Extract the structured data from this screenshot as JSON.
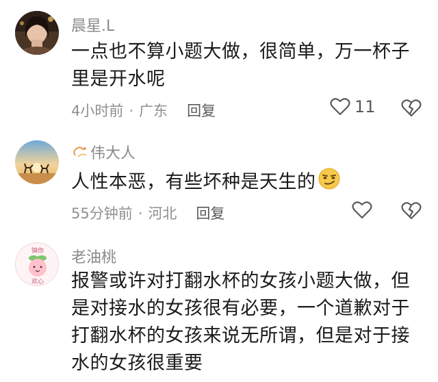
{
  "comments": [
    {
      "username": "晨星.L",
      "text_lines": [
        "一点也不算小题大做，很简单，万一杯子",
        "里是开水呢"
      ],
      "time": "4小时前",
      "location": "广东",
      "reply_label": "回复",
      "like_count": "11",
      "avatar_icon": "photo-avatar-icon"
    },
    {
      "username": "伟大人",
      "text_lines": [
        "人性本恶，有些坏种是天生的"
      ],
      "time": "55分钟前",
      "location": "河北",
      "reply_label": "回复",
      "like_count": "",
      "avatar_icon": "sunset-deer-avatar-icon",
      "emoji_icon": "smirk-emoji-icon"
    },
    {
      "username": "老油桃",
      "text_lines": [
        "报警或许对打翻水杯的女孩小题大做，但",
        "是对接水的女孩很有必要，一个道歉对于",
        "打翻水杯的女孩来说无所谓，但是对于接",
        "水的女孩很重要"
      ],
      "avatar_icon": "peach-avatar-icon",
      "avatar_text": [
        "锦你",
        "欢心"
      ]
    }
  ],
  "separator": "·",
  "colors": {
    "text": "#1a1a1a",
    "meta": "#8f8f8f",
    "username": "#8a8a8a",
    "icon": "#595959"
  }
}
